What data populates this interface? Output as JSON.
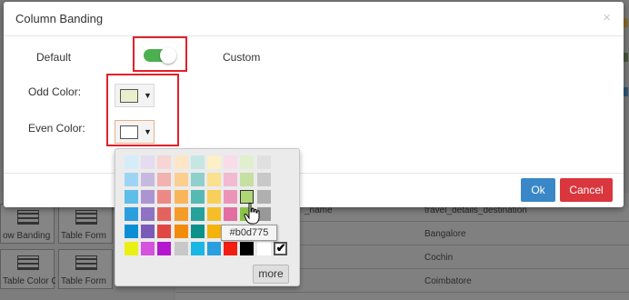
{
  "dialog": {
    "title": "Column Banding",
    "close_glyph": "×",
    "default_label": "Default",
    "custom_label": "Custom",
    "toggle_on": true,
    "toggle_color": "#4caf50",
    "odd_label": "Odd Color:",
    "odd_color": "#e8efcc",
    "even_label": "Even Color:",
    "even_color": "#ffffff",
    "ok_label": "Ok",
    "cancel_label": "Cancel",
    "ok_color": "#3a87c8",
    "cancel_color": "#d9363e",
    "highlight_color": "#e3202a"
  },
  "palette": {
    "rows": [
      [
        "#d5ecfa",
        "#e4dcf0",
        "#f6d5d4",
        "#fde6c6",
        "#c6e6e4",
        "#fdf0c6",
        "#f8dde9",
        "#e2efcf",
        "#e0e0e0"
      ],
      [
        "#9ed4f3",
        "#c7b8e0",
        "#f2b2b0",
        "#fbcf8f",
        "#8fd0cd",
        "#fbe08f",
        "#f1b9d2",
        "#c5e0a0",
        "#c8c8c8"
      ],
      [
        "#5ebde9",
        "#aa95d1",
        "#ec8986",
        "#f8b55a",
        "#56b9b4",
        "#f8cf5a",
        "#ea94ba",
        "#b0d775",
        "#b0b0b0"
      ],
      [
        "#2a9fde",
        "#8d73c2",
        "#e4625e",
        "#f59b28",
        "#27a19b",
        "#f5be28",
        "#e26fa2",
        "#8bc34a",
        "#989898"
      ],
      [
        "#0a8fd6",
        "#7a5bb8",
        "#e04743",
        "#f28b0c",
        "#0c918a",
        "#f3b30c",
        "#dc5690",
        "#6fa935",
        "#7d7d7d"
      ],
      [
        "#e8f016",
        "#d452dc",
        "#b517d0",
        "#c8c8c8",
        "#1bb6e2",
        "#2a9fde",
        "#f21d13",
        "#000000",
        "#ffffff",
        "#ffffff"
      ]
    ],
    "selected_row": 2,
    "selected_col": 7,
    "tooltip": "#b0d775",
    "more_label": "more"
  },
  "background": {
    "tiles": [
      {
        "label": "ow Banding"
      },
      {
        "label": "Table Form"
      },
      {
        "label": "Table Color C..."
      },
      {
        "label": "Table Form"
      }
    ],
    "rows": [
      {
        "col1": "_name",
        "col2": "travel_details_destination"
      },
      {
        "col1": "",
        "col2": "Bangalore"
      },
      {
        "col1": "",
        "col2": "Cochin"
      },
      {
        "col1": "",
        "col2": "Coimbatore"
      }
    ]
  }
}
